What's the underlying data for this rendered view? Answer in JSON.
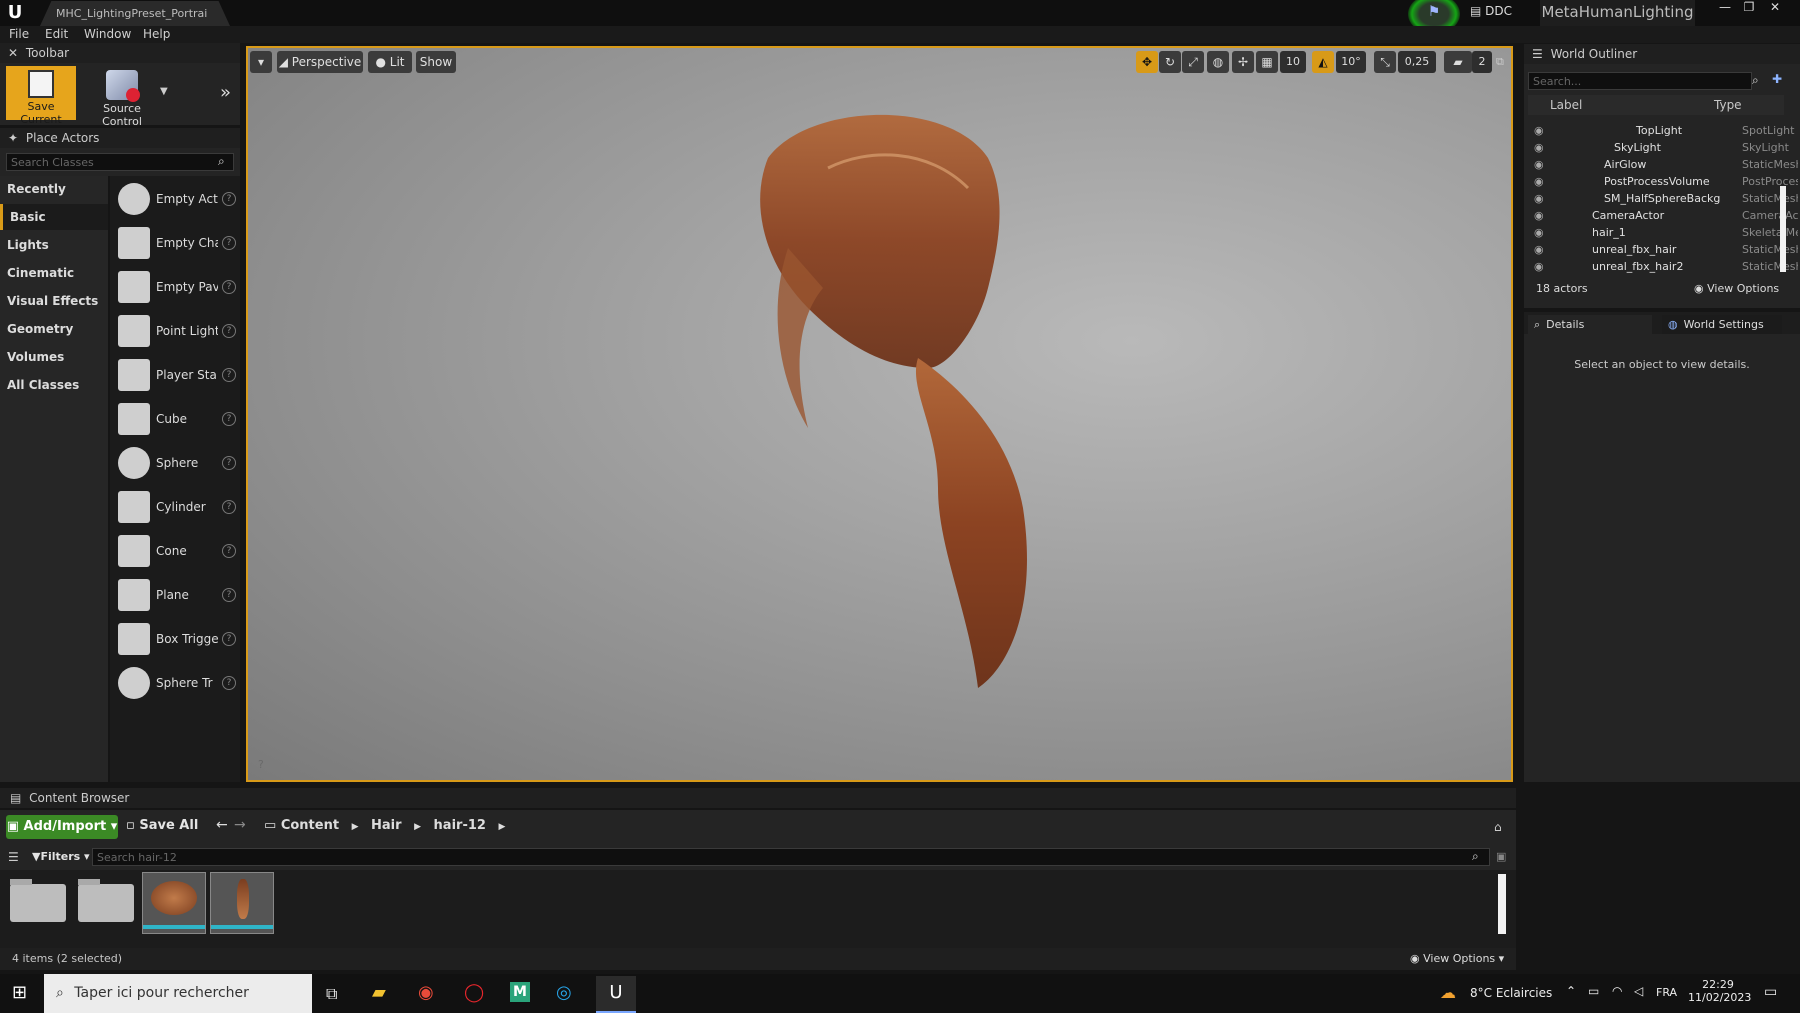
{
  "titlebar": {
    "doc_tab": "MHC_LightingPreset_Portrai",
    "ddc_label": "DDC",
    "project_name": "MetaHumanLighting"
  },
  "menu": [
    "File",
    "Edit",
    "Window",
    "Help"
  ],
  "toolbar": {
    "title": "Toolbar",
    "save_current": "Save Current",
    "source_control": "Source Control"
  },
  "place_actors": {
    "title": "Place Actors",
    "search_placeholder": "Search Classes",
    "categories": [
      "Recently Placed",
      "Basic",
      "Lights",
      "Cinematic",
      "Visual Effects",
      "Geometry",
      "Volumes",
      "All Classes"
    ],
    "selected_category": "Basic",
    "items": [
      "Empty Act",
      "Empty Cha",
      "Empty Pav",
      "Point Light",
      "Player Sta",
      "Cube",
      "Sphere",
      "Cylinder",
      "Cone",
      "Plane",
      "Box Trigge",
      "Sphere Tr"
    ]
  },
  "viewport": {
    "perspective": "Perspective",
    "lit": "Lit",
    "show": "Show",
    "grid_snap": "10",
    "rot_snap": "10°",
    "scale_snap": "0,25",
    "cam_speed": "2"
  },
  "outliner": {
    "title": "World Outliner",
    "search_placeholder": "Search...",
    "col_label": "Label",
    "col_type": "Type",
    "rows": [
      {
        "label": "TopLight",
        "type": "SpotLight"
      },
      {
        "label": "SkyLight",
        "type": "SkyLight"
      },
      {
        "label": "AirGlow",
        "type": "StaticMeshAc"
      },
      {
        "label": "PostProcessVolume",
        "type": "PostProcess\\"
      },
      {
        "label": "SM_HalfSphereBackg",
        "type": "StaticMeshAc"
      },
      {
        "label": "CameraActor",
        "type": "CameraActor"
      },
      {
        "label": "hair_1",
        "type": "SkeletalMesh"
      },
      {
        "label": "unreal_fbx_hair",
        "type": "StaticMeshAc"
      },
      {
        "label": "unreal_fbx_hair2",
        "type": "StaticMeshAc"
      }
    ],
    "actor_count": "18 actors",
    "view_options": "View Options"
  },
  "details": {
    "tab_details": "Details",
    "tab_world": "World Settings",
    "empty_msg": "Select an object to view details."
  },
  "content_browser": {
    "title": "Content Browser",
    "add_import": "Add/Import",
    "save_all": "Save All",
    "path": [
      "Content",
      "Hair",
      "hair-12"
    ],
    "filters": "Filters",
    "search_placeholder": "Search hair-12",
    "status": "4 items (2 selected)",
    "view_options": "View Options"
  },
  "taskbar": {
    "search_placeholder": "Taper ici pour rechercher",
    "weather": "8°C  Eclaircies",
    "lang": "FRA",
    "time": "22:29",
    "date": "11/02/2023"
  },
  "colors": {
    "accent": "#d89a18",
    "add_green": "#3b8a25",
    "cyan": "#2fb5c8"
  }
}
